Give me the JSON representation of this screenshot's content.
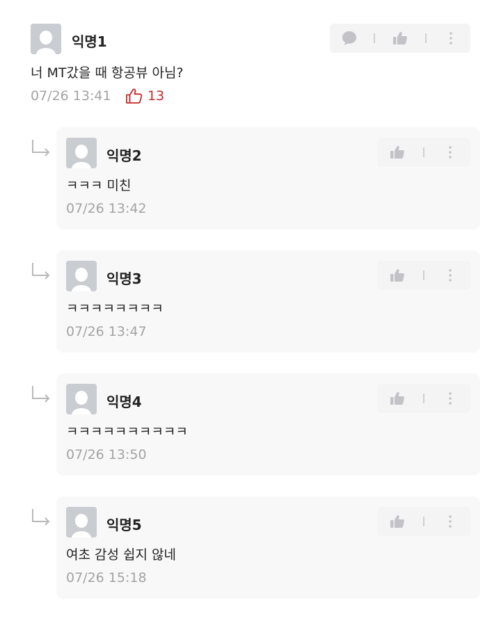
{
  "comment": {
    "nickname": "익명1",
    "text": "너 MT갔을 때 항공뷰 아님?",
    "time": "07/26 13:41",
    "like_count": "13"
  },
  "replies": [
    {
      "nickname": "익명2",
      "text": "ㅋㅋㅋ 미친",
      "time": "07/26 13:42"
    },
    {
      "nickname": "익명3",
      "text": "ㅋㅋㅋㅋㅋㅋㅋㅋ",
      "time": "07/26 13:47"
    },
    {
      "nickname": "익명4",
      "text": "ㅋㅋㅋㅋㅋㅋㅋㅋㅋㅋ",
      "time": "07/26 13:50"
    },
    {
      "nickname": "익명5",
      "text": "여초 감성 쉽지 않네",
      "time": "07/26 15:18"
    }
  ],
  "icons": {
    "reply": "speech-bubble-icon",
    "like": "thumbs-up-icon",
    "more": "more-vertical-icon",
    "reply_arrow": "reply-arrow-icon",
    "avatar": "anonymous-avatar-icon"
  },
  "colors": {
    "accent": "#c62828",
    "toolbar_bg": "#f4f4f5",
    "reply_bg": "#f8f8f9",
    "muted_text": "#a3a3a3",
    "icon": "#c3c3c7"
  }
}
